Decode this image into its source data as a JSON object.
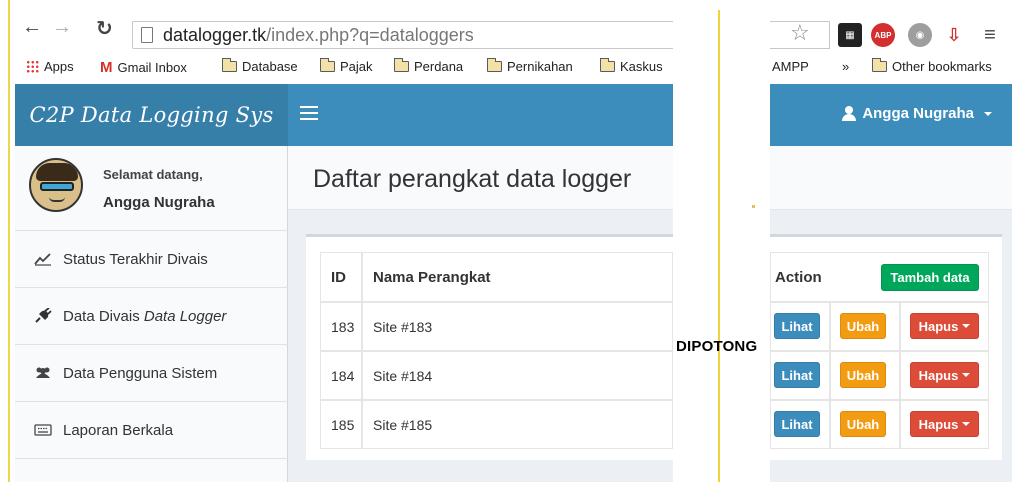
{
  "browser": {
    "url_host": "datalogger.tk",
    "url_rest": "/index.php?q=dataloggers",
    "bookmarks": {
      "apps": "Apps",
      "gmail": "Gmail Inbox",
      "database": "Database",
      "pajak": "Pajak",
      "perdana": "Perdana",
      "pernikahan": "Pernikahan",
      "kaskus": "Kaskus",
      "xampp_partial": "AMPP",
      "overflow": "»",
      "other": "Other bookmarks"
    },
    "abp_label": "ABP"
  },
  "app": {
    "brand": "C2P Data Logging Sys",
    "user_menu_name": "Angga Nugraha"
  },
  "sidebar": {
    "greeting": "Selamat datang,",
    "user_name": "Angga Nugraha",
    "items": [
      {
        "label": "Status Terakhir Divais",
        "icon": "line-chart-icon"
      },
      {
        "label_prefix": "Data Divais ",
        "label_italic": "Data Logger",
        "icon": "plug-icon"
      },
      {
        "label": "Data Pengguna Sistem",
        "icon": "users-icon"
      },
      {
        "label": "Laporan Berkala",
        "icon": "keyboard-icon"
      }
    ]
  },
  "page": {
    "title": "Daftar perangkat data logger"
  },
  "table": {
    "headers": {
      "id": "ID",
      "name": "Nama Perangkat",
      "action": "Action"
    },
    "add_button": "Tambah data",
    "rows": [
      {
        "id": "183",
        "name": "Site #183"
      },
      {
        "id": "184",
        "name": "Site #184"
      },
      {
        "id": "185",
        "name": "Site #185"
      }
    ],
    "row_buttons": {
      "view": "Lihat",
      "edit": "Ubah",
      "delete": "Hapus"
    }
  },
  "annotation": {
    "cut_label": "DIPOTONG"
  },
  "colors": {
    "brand_bg": "#367fa9",
    "navbar_bg": "#3c8dbc",
    "btn_view": "#3c8dbc",
    "btn_edit": "#f39c12",
    "btn_delete": "#dd4b39",
    "btn_add": "#00a65a"
  }
}
